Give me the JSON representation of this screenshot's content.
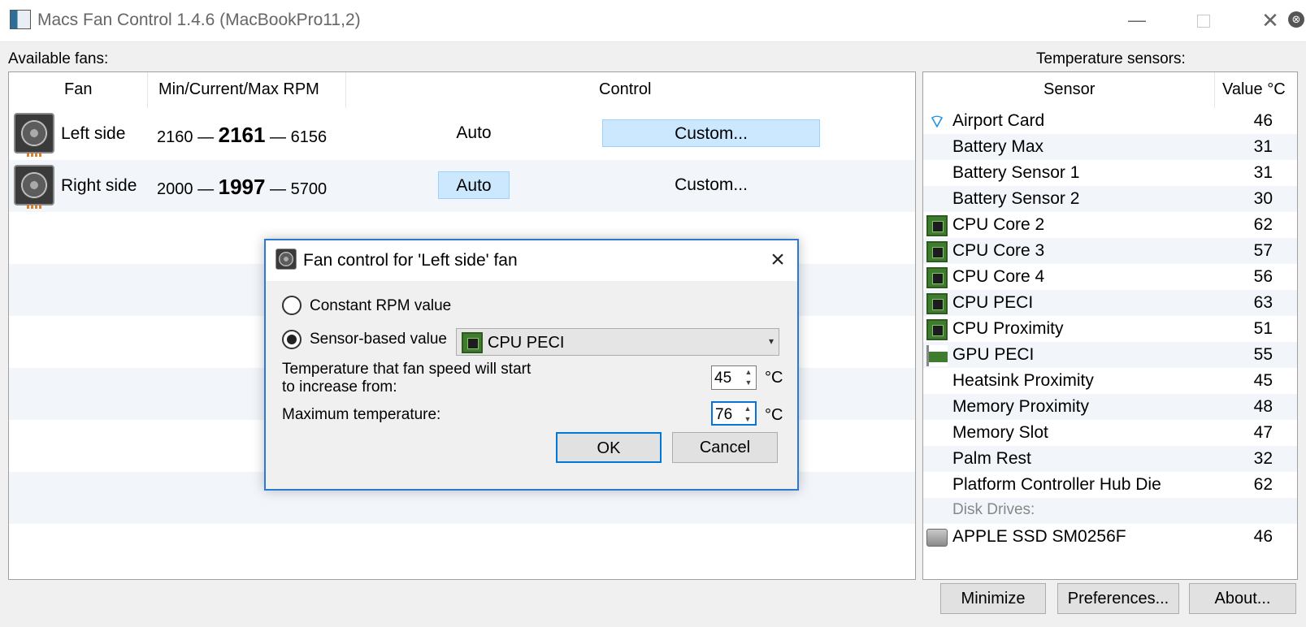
{
  "window": {
    "title": "Macs Fan Control 1.4.6 (MacBookPro11,2)",
    "minimize": "—",
    "close": "✕"
  },
  "fans_label": "Available fans:",
  "sensors_label": "Temperature sensors:",
  "fans_table": {
    "headers": {
      "fan": "Fan",
      "rpm": "Min/Current/Max RPM",
      "control": "Control"
    },
    "rows": [
      {
        "name": "Left side",
        "min": "2160",
        "current": "2161",
        "max": "6156",
        "auto": "Auto",
        "custom": "Custom...",
        "active": "custom"
      },
      {
        "name": "Right side",
        "min": "2000",
        "current": "1997",
        "max": "5700",
        "auto": "Auto",
        "custom": "Custom...",
        "active": "auto"
      }
    ],
    "separator": "—"
  },
  "sensors_table": {
    "headers": {
      "sensor": "Sensor",
      "value": "Value °C"
    },
    "rows": [
      {
        "icon": "wifi-icon",
        "name": "Airport Card",
        "value": "46"
      },
      {
        "icon": "",
        "name": "Battery Max",
        "value": "31"
      },
      {
        "icon": "",
        "name": "Battery Sensor 1",
        "value": "31"
      },
      {
        "icon": "",
        "name": "Battery Sensor 2",
        "value": "30"
      },
      {
        "icon": "cpu-chip-icon",
        "name": "CPU Core 2",
        "value": "62"
      },
      {
        "icon": "cpu-chip-icon",
        "name": "CPU Core 3",
        "value": "57"
      },
      {
        "icon": "cpu-chip-icon",
        "name": "CPU Core 4",
        "value": "56"
      },
      {
        "icon": "cpu-chip-icon",
        "name": "CPU PECI",
        "value": "63"
      },
      {
        "icon": "cpu-chip-icon",
        "name": "CPU Proximity",
        "value": "51"
      },
      {
        "icon": "gpu-card-icon",
        "name": "GPU PECI",
        "value": "55"
      },
      {
        "icon": "",
        "name": "Heatsink Proximity",
        "value": "45"
      },
      {
        "icon": "",
        "name": "Memory Proximity",
        "value": "48"
      },
      {
        "icon": "",
        "name": "Memory Slot",
        "value": "47"
      },
      {
        "icon": "",
        "name": "Palm Rest",
        "value": "32"
      },
      {
        "icon": "",
        "name": "Platform Controller Hub Die",
        "value": "62"
      }
    ],
    "disk_group": "Disk Drives:",
    "disk": {
      "icon": "disk-drive-icon",
      "name": "APPLE SSD SM0256F",
      "value": "46"
    }
  },
  "bottom_buttons": {
    "minimize": "Minimize",
    "preferences": "Preferences...",
    "about": "About..."
  },
  "dialog": {
    "title": "Fan control for 'Left side' fan",
    "option_constant": "Constant RPM value",
    "option_sensor": "Sensor-based value",
    "selected_option": "sensor",
    "sensor_select": "CPU PECI",
    "start_temp_label_1": "Temperature that fan speed will start",
    "start_temp_label_2": "to increase from:",
    "start_temp": "45",
    "max_temp_label": "Maximum temperature:",
    "max_temp": "76",
    "unit": "°C",
    "ok": "OK",
    "cancel": "Cancel"
  },
  "colors": {
    "accent": "#0078d7",
    "selected_bg": "#cce8ff",
    "stripe": "#f2f6fb"
  }
}
